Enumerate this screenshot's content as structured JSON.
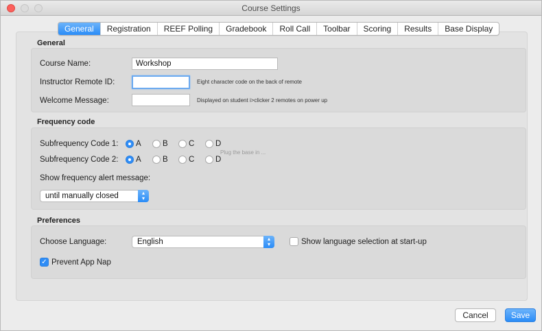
{
  "window": {
    "title": "Course Settings"
  },
  "tabs": [
    {
      "label": "General",
      "active": true
    },
    {
      "label": "Registration"
    },
    {
      "label": "REEF Polling"
    },
    {
      "label": "Gradebook"
    },
    {
      "label": "Roll Call"
    },
    {
      "label": "Toolbar"
    },
    {
      "label": "Scoring"
    },
    {
      "label": "Results"
    },
    {
      "label": "Base Display"
    }
  ],
  "general": {
    "title": "General",
    "course_name_label": "Course Name:",
    "course_name_value": "Workshop",
    "remote_id_label": "Instructor Remote ID:",
    "remote_id_value": "",
    "remote_id_hint": "Eight character code on the back of remote",
    "welcome_label": "Welcome Message:",
    "welcome_value": "",
    "welcome_hint": "Displayed on student i>clicker 2 remotes on power up"
  },
  "frequency": {
    "title": "Frequency code",
    "sub1_label": "Subfrequency Code 1:",
    "sub2_label": "Subfrequency Code 2:",
    "options": [
      "A",
      "B",
      "C",
      "D"
    ],
    "sub1_selected": "A",
    "sub2_selected": "A",
    "base_hint": "Plug the base in ...",
    "alert_label": "Show frequency alert message:",
    "alert_value": "until manually closed"
  },
  "preferences": {
    "title": "Preferences",
    "language_label": "Choose Language:",
    "language_value": "English",
    "show_language_label": "Show language selection at start-up",
    "show_language_checked": false,
    "app_nap_label": "Prevent App Nap",
    "app_nap_checked": true
  },
  "buttons": {
    "cancel": "Cancel",
    "save": "Save"
  },
  "colors": {
    "accent": "#2f8df6",
    "close": "#fc605c"
  }
}
